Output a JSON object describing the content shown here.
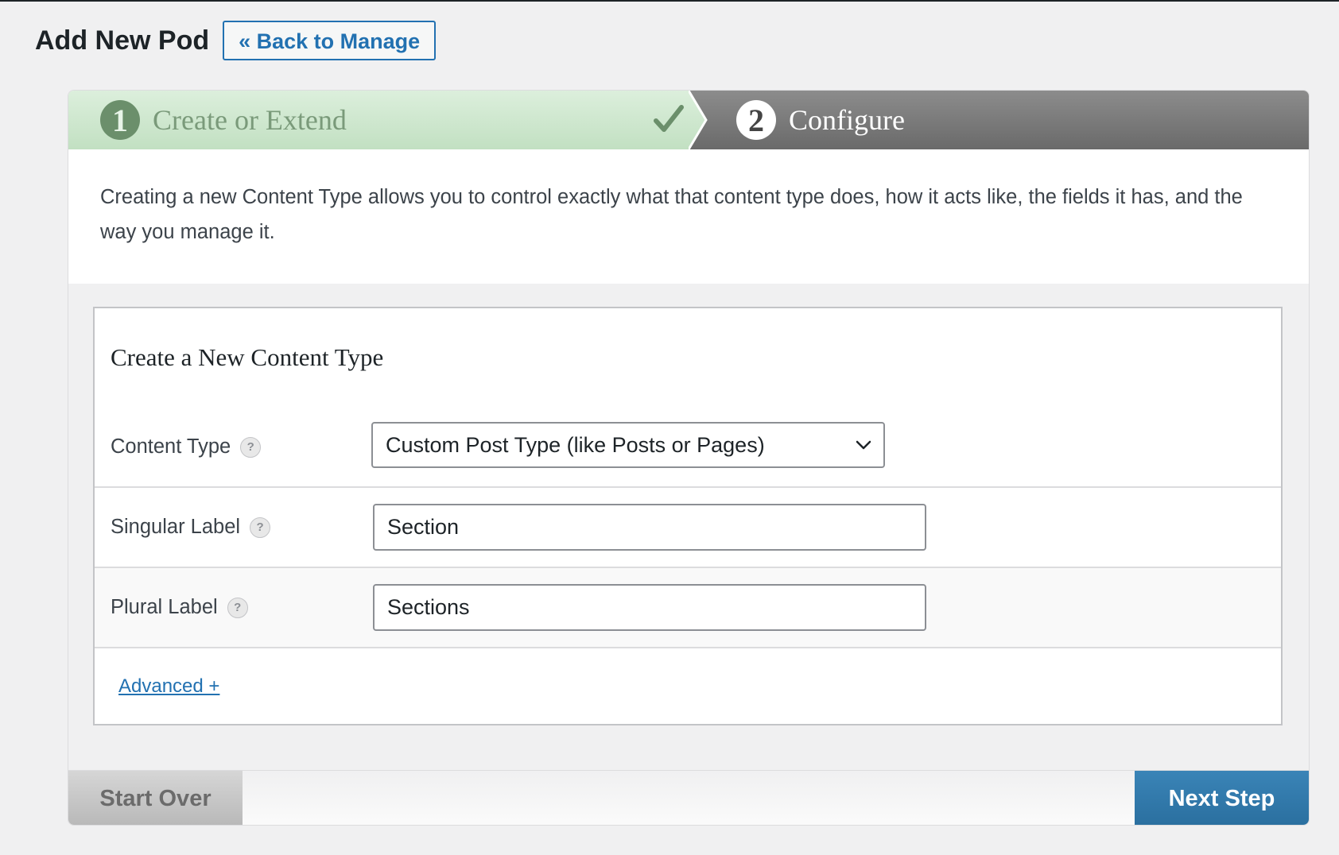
{
  "header": {
    "title": "Add New Pod",
    "back_label": "« Back to Manage"
  },
  "steps": [
    {
      "number": "1",
      "label": "Create or Extend",
      "status": "complete"
    },
    {
      "number": "2",
      "label": "Configure",
      "status": "current"
    }
  ],
  "intro": "Creating a new Content Type allows you to control exactly what that content type does, how it acts like, the fields it has, and the way you manage it.",
  "form": {
    "heading": "Create a New Content Type",
    "content_type": {
      "label": "Content Type",
      "value": "Custom Post Type (like Posts or Pages)"
    },
    "singular": {
      "label": "Singular Label",
      "value": "Section"
    },
    "plural": {
      "label": "Plural Label",
      "value": "Sections"
    },
    "help_glyph": "?",
    "advanced_label": "Advanced +"
  },
  "footer": {
    "start_over_label": "Start Over",
    "next_step_label": "Next Step"
  },
  "colors": {
    "accent": "#2271b1",
    "step_done_bg": "#c8e4c8",
    "step_current_bg": "#777777",
    "next_button": "#3a84b7"
  }
}
